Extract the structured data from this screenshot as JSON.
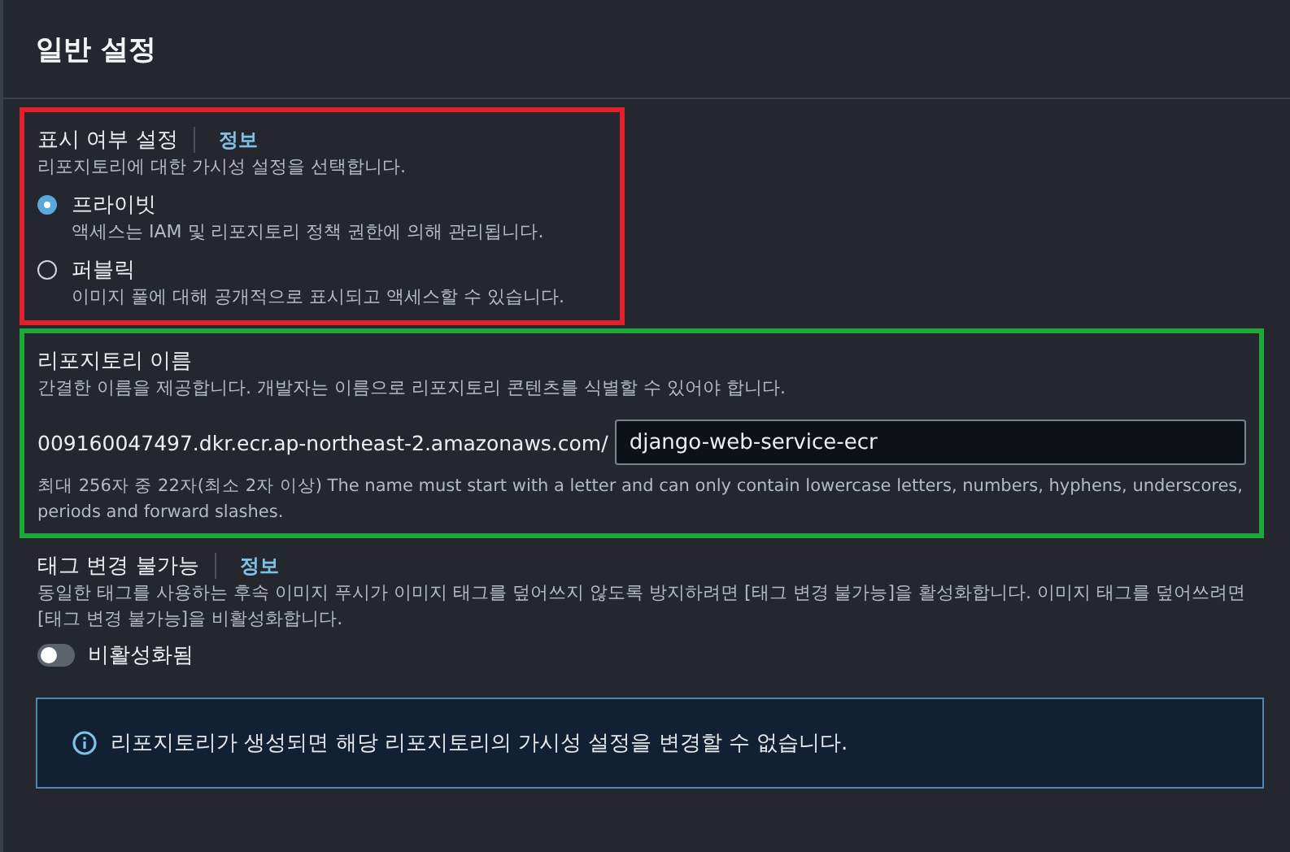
{
  "header": {
    "title": "일반 설정"
  },
  "visibility": {
    "color": "#e0202a",
    "label": "표시 여부 설정",
    "info": "정보",
    "description": "리포지토리에 대한 가시성 설정을 선택합니다.",
    "options": [
      {
        "label": "프라이빗",
        "description": "액세스는 IAM 및 리포지토리 정책 권한에 의해 관리됩니다.",
        "selected": true
      },
      {
        "label": "퍼블릭",
        "description": "이미지 풀에 대해 공개적으로 표시되고 액세스할 수 있습니다.",
        "selected": false
      }
    ]
  },
  "repository_name": {
    "color": "#1fa83a",
    "label": "리포지토리 이름",
    "description": "간결한 이름을 제공합니다. 개발자는 이름으로 리포지토리 콘텐츠를 식별할 수 있어야 합니다.",
    "prefix": "009160047497.dkr.ecr.ap-northeast-2.amazonaws.com/",
    "value": "django-web-service-ecr",
    "hint": "최대 256자 중 22자(최소 2자 이상) The name must start with a letter and can only contain lowercase letters, numbers, hyphens, underscores, periods and forward slashes."
  },
  "tag_immutability": {
    "label": "태그 변경 불가능",
    "info": "정보",
    "description": "동일한 태그를 사용하는 후속 이미지 푸시가 이미지 태그를 덮어쓰지 않도록 방지하려면 [태그 변경 불가능]을 활성화합니다. 이미지 태그를 덮어쓰려면 [태그 변경 불가능]을 비활성화합니다.",
    "on": false,
    "state_label": "비활성화됨"
  },
  "alert": {
    "message": "리포지토리가 생성되면 해당 리포지토리의 가시성 설정을 변경할 수 없습니다."
  }
}
